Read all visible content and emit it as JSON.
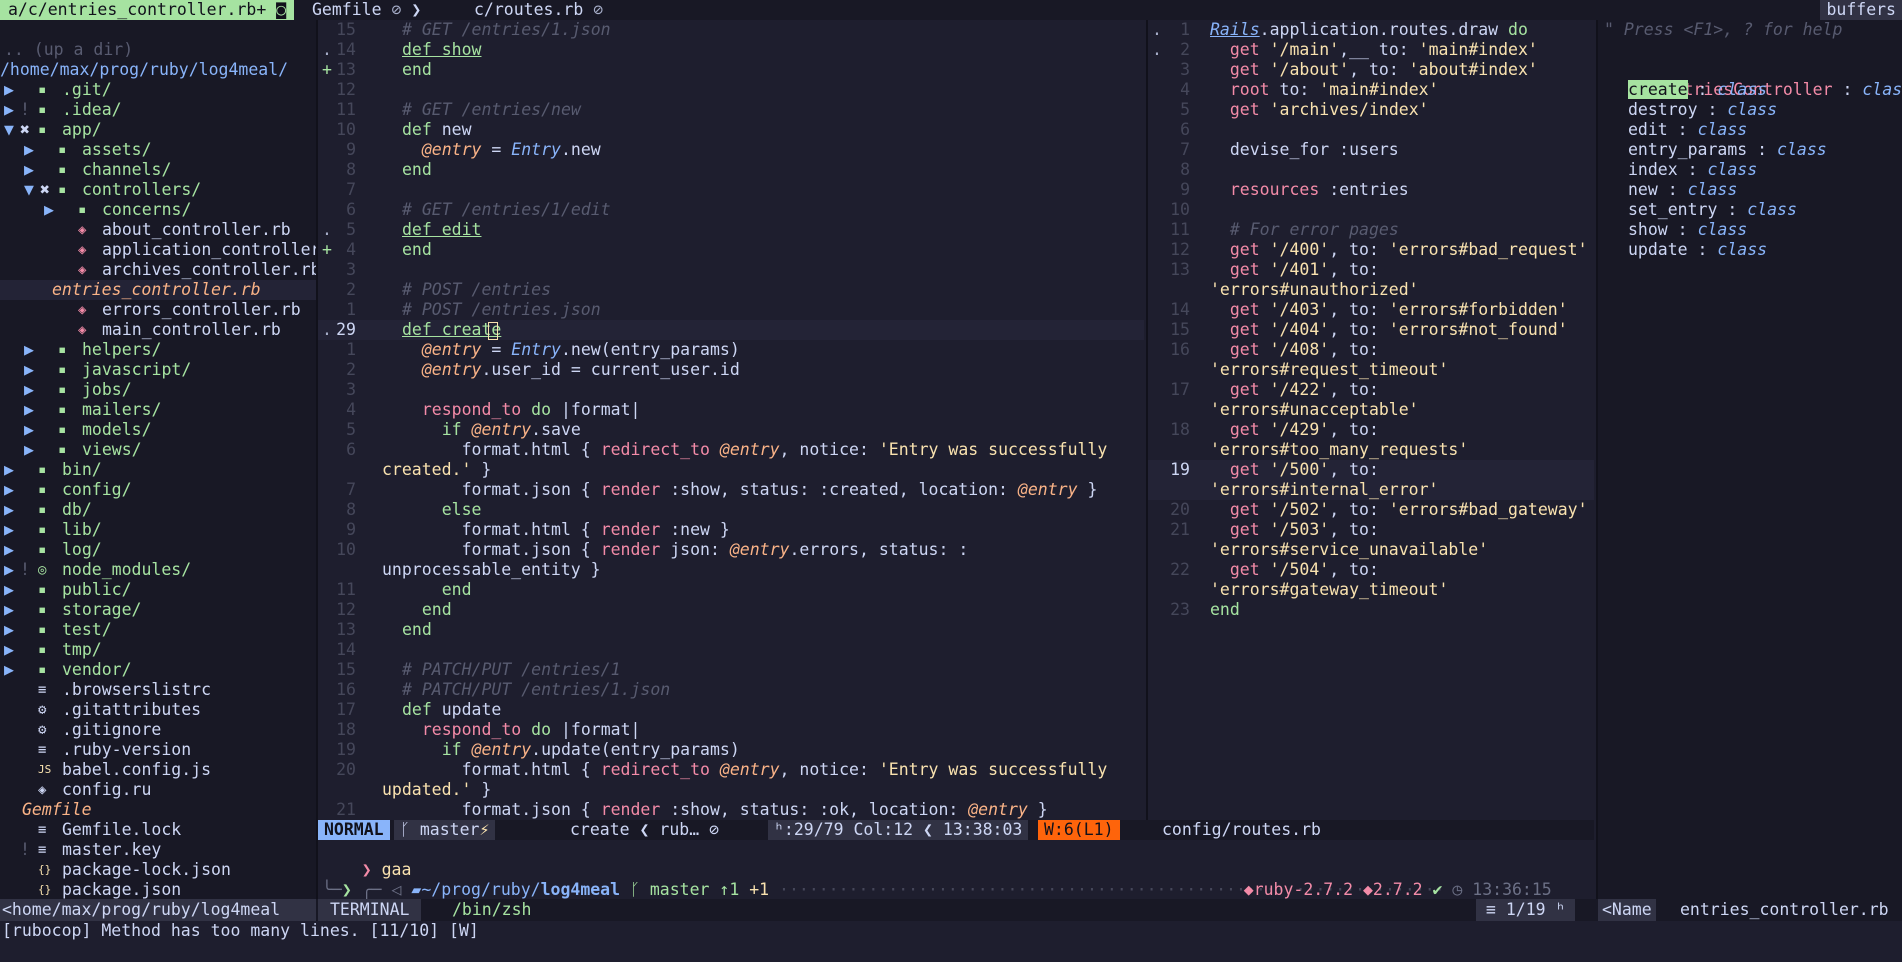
{
  "tabline": {
    "active_tab": "a/c/entries_controller.rb+",
    "tab2": "Gemfile",
    "tab3": "c/routes.rb",
    "buffers_label": "buffers"
  },
  "tree": {
    "up_dir": ".. (up a dir)",
    "root_path": "/home/max/prog/ruby/log4meal/",
    "items": [
      {
        "arrow": "▶",
        "mark": "",
        "icon": "▪",
        "label": ".git/",
        "type": "dir",
        "indent": 1
      },
      {
        "arrow": "▶",
        "mark": "!",
        "icon": "▪",
        "label": ".idea/",
        "type": "dir",
        "indent": 1
      },
      {
        "arrow": "▼",
        "mark": "✖",
        "icon": "▪",
        "label": "app/",
        "type": "dir",
        "indent": 1
      },
      {
        "arrow": "▶",
        "mark": "",
        "icon": "▪",
        "label": "assets/",
        "type": "dir",
        "indent": 3
      },
      {
        "arrow": "▶",
        "mark": "",
        "icon": "▪",
        "label": "channels/",
        "type": "dir",
        "indent": 3
      },
      {
        "arrow": "▼",
        "mark": "✖",
        "icon": "▪",
        "label": "controllers/",
        "type": "dir",
        "indent": 3
      },
      {
        "arrow": "▶",
        "mark": "",
        "icon": "▪",
        "label": "concerns/",
        "type": "dir",
        "indent": 5
      },
      {
        "arrow": "",
        "mark": "",
        "icon": "◈",
        "label": "about_controller.rb",
        "type": "ruby",
        "indent": 5
      },
      {
        "arrow": "",
        "mark": "",
        "icon": "◈",
        "label": "application_controller",
        "type": "ruby",
        "indent": 5
      },
      {
        "arrow": "",
        "mark": "",
        "icon": "◈",
        "label": "archives_controller.rb",
        "type": "ruby",
        "indent": 5
      },
      {
        "arrow": "",
        "mark": "",
        "icon": "",
        "label": "entries_controller.rb",
        "type": "active",
        "indent": 3
      },
      {
        "arrow": "",
        "mark": "",
        "icon": "◈",
        "label": "errors_controller.rb",
        "type": "ruby",
        "indent": 5
      },
      {
        "arrow": "",
        "mark": "",
        "icon": "◈",
        "label": "main_controller.rb",
        "type": "ruby",
        "indent": 5
      },
      {
        "arrow": "▶",
        "mark": "",
        "icon": "▪",
        "label": "helpers/",
        "type": "dir",
        "indent": 3
      },
      {
        "arrow": "▶",
        "mark": "",
        "icon": "▪",
        "label": "javascript/",
        "type": "dir",
        "indent": 3
      },
      {
        "arrow": "▶",
        "mark": "",
        "icon": "▪",
        "label": "jobs/",
        "type": "dir",
        "indent": 3
      },
      {
        "arrow": "▶",
        "mark": "",
        "icon": "▪",
        "label": "mailers/",
        "type": "dir",
        "indent": 3
      },
      {
        "arrow": "▶",
        "mark": "",
        "icon": "▪",
        "label": "models/",
        "type": "dir",
        "indent": 3
      },
      {
        "arrow": "▶",
        "mark": "",
        "icon": "▪",
        "label": "views/",
        "type": "dir",
        "indent": 3
      },
      {
        "arrow": "▶",
        "mark": "",
        "icon": "▪",
        "label": "bin/",
        "type": "dir",
        "indent": 1
      },
      {
        "arrow": "▶",
        "mark": "",
        "icon": "▪",
        "label": "config/",
        "type": "dir",
        "indent": 1
      },
      {
        "arrow": "▶",
        "mark": "",
        "icon": "▪",
        "label": "db/",
        "type": "dir",
        "indent": 1
      },
      {
        "arrow": "▶",
        "mark": "",
        "icon": "▪",
        "label": "lib/",
        "type": "dir",
        "indent": 1
      },
      {
        "arrow": "▶",
        "mark": "",
        "icon": "▪",
        "label": "log/",
        "type": "dir",
        "indent": 1
      },
      {
        "arrow": "▶",
        "mark": "!",
        "icon": "◎",
        "label": "node_modules/",
        "type": "dir",
        "indent": 1
      },
      {
        "arrow": "▶",
        "mark": "",
        "icon": "▪",
        "label": "public/",
        "type": "dir",
        "indent": 1
      },
      {
        "arrow": "▶",
        "mark": "",
        "icon": "▪",
        "label": "storage/",
        "type": "dir",
        "indent": 1
      },
      {
        "arrow": "▶",
        "mark": "",
        "icon": "▪",
        "label": "test/",
        "type": "dir",
        "indent": 1
      },
      {
        "arrow": "▶",
        "mark": "",
        "icon": "▪",
        "label": "tmp/",
        "type": "dir",
        "indent": 1
      },
      {
        "arrow": "▶",
        "mark": "",
        "icon": "▪",
        "label": "vendor/",
        "type": "dir",
        "indent": 1
      },
      {
        "arrow": "",
        "mark": "",
        "icon": "≡",
        "label": ".browserslistrc",
        "type": "file",
        "indent": 1
      },
      {
        "arrow": "",
        "mark": "",
        "icon": "⚙",
        "label": ".gitattributes",
        "type": "file",
        "indent": 1
      },
      {
        "arrow": "",
        "mark": "",
        "icon": "⚙",
        "label": ".gitignore",
        "type": "file",
        "indent": 1
      },
      {
        "arrow": "",
        "mark": "",
        "icon": "≡",
        "label": ".ruby-version",
        "type": "file",
        "indent": 1
      },
      {
        "arrow": "",
        "mark": "",
        "icon": "JS",
        "label": "babel.config.js",
        "type": "js",
        "indent": 1
      },
      {
        "arrow": "",
        "mark": "",
        "icon": "◈",
        "label": "config.ru",
        "type": "file",
        "indent": 1
      },
      {
        "arrow": "",
        "mark": "",
        "icon": "",
        "label": "Gemfile",
        "type": "gemfile",
        "indent": 0
      },
      {
        "arrow": "",
        "mark": "",
        "icon": "≡",
        "label": "Gemfile.lock",
        "type": "file",
        "indent": 1
      },
      {
        "arrow": "",
        "mark": "!",
        "icon": "≡",
        "label": "master.key",
        "type": "file",
        "indent": 1
      },
      {
        "arrow": "",
        "mark": "",
        "icon": "{}",
        "label": "package-lock.json",
        "type": "json",
        "indent": 1
      },
      {
        "arrow": "",
        "mark": "",
        "icon": "{}",
        "label": "package.json",
        "type": "json",
        "indent": 1
      }
    ]
  },
  "editor": {
    "lines": [
      {
        "n": "15",
        "sign": "",
        "html": "<span class='cm'># GET /entries/1.json</span>"
      },
      {
        "n": "14",
        "sign": ".",
        "html": "<span class='def'>def show</span>"
      },
      {
        "n": "13",
        "sign": "+",
        "html": "<span class='kw'>end</span>"
      },
      {
        "n": "12",
        "sign": "",
        "html": ""
      },
      {
        "n": "11",
        "sign": "",
        "html": "<span class='cm'># GET /entries/new</span>"
      },
      {
        "n": "10",
        "sign": "",
        "html": "<span class='kw'>def</span> new"
      },
      {
        "n": "9",
        "sign": "",
        "html": "  <span class='iv'>@entry</span> = <span class='cls'>Entry</span>.new"
      },
      {
        "n": "8",
        "sign": "",
        "html": "<span class='kw'>end</span>"
      },
      {
        "n": "7",
        "sign": "",
        "html": ""
      },
      {
        "n": "6",
        "sign": "",
        "html": "<span class='cm'># GET /entries/1/edit</span>"
      },
      {
        "n": "5",
        "sign": ".",
        "html": "<span class='def'>def edit</span>"
      },
      {
        "n": "4",
        "sign": "+",
        "html": "<span class='kw'>end</span>"
      },
      {
        "n": "3",
        "sign": "",
        "html": ""
      },
      {
        "n": "2",
        "sign": "",
        "html": "<span class='cm'># POST /entries</span>"
      },
      {
        "n": "1",
        "sign": "",
        "html": "<span class='cm'># POST /entries.json</span>"
      },
      {
        "n": "29",
        "sign": ".",
        "cur": true,
        "html": "<span class='def'>def create</span>"
      },
      {
        "n": "1",
        "sign": "",
        "html": "  <span class='iv'>@entry</span> = <span class='cls'>Entry</span>.new(entry_params)"
      },
      {
        "n": "2",
        "sign": "",
        "html": "  <span class='iv'>@entry</span>.user_id = current_user.id"
      },
      {
        "n": "3",
        "sign": "",
        "html": ""
      },
      {
        "n": "4",
        "sign": "",
        "html": "  <span class='meth'>respond_to</span> <span class='kw'>do</span> |format|"
      },
      {
        "n": "5",
        "sign": "",
        "html": "    <span class='kw'>if</span> <span class='iv'>@entry</span>.save"
      },
      {
        "n": "6",
        "sign": "",
        "html": "      format.html { <span class='meth'>redirect_to</span> <span class='iv'>@entry</span>, notice: <span class='str'>'Entry was successfully</span>"
      },
      {
        "n": "",
        "sign": "",
        "wrap": true,
        "html": "<span class='str'>created.'</span> }"
      },
      {
        "n": "7",
        "sign": "",
        "html": "      format.json { <span class='meth'>render</span> :show, status: :created, location: <span class='iv'>@entry</span> }"
      },
      {
        "n": "8",
        "sign": "",
        "html": "    <span class='kw'>else</span>"
      },
      {
        "n": "9",
        "sign": "",
        "html": "      format.html { <span class='meth'>render</span> :new }"
      },
      {
        "n": "10",
        "sign": "",
        "html": "      format.json { <span class='meth'>render</span> json: <span class='iv'>@entry</span>.errors, status: :"
      },
      {
        "n": "",
        "sign": "",
        "wrap": true,
        "html": "unprocessable_entity }"
      },
      {
        "n": "11",
        "sign": "",
        "html": "    <span class='kw'>end</span>"
      },
      {
        "n": "12",
        "sign": "",
        "html": "  <span class='kw'>end</span>"
      },
      {
        "n": "13",
        "sign": "",
        "html": "<span class='kw'>end</span>"
      },
      {
        "n": "14",
        "sign": "",
        "html": ""
      },
      {
        "n": "15",
        "sign": "",
        "html": "<span class='cm'># PATCH/PUT /entries/1</span>"
      },
      {
        "n": "16",
        "sign": "",
        "html": "<span class='cm'># PATCH/PUT /entries/1.json</span>"
      },
      {
        "n": "17",
        "sign": "",
        "html": "<span class='kw'>def</span> update"
      },
      {
        "n": "18",
        "sign": "",
        "html": "  <span class='meth'>respond_to</span> <span class='kw'>do</span> |format|"
      },
      {
        "n": "19",
        "sign": "",
        "html": "    <span class='kw'>if</span> <span class='iv'>@entry</span>.update(entry_params)"
      },
      {
        "n": "20",
        "sign": "",
        "html": "      format.html { <span class='meth'>redirect_to</span> <span class='iv'>@entry</span>, notice: <span class='str'>'Entry was successfully</span>"
      },
      {
        "n": "",
        "sign": "",
        "wrap": true,
        "html": "<span class='str'>updated.'</span> }"
      },
      {
        "n": "21",
        "sign": "",
        "html": "      format.json { <span class='meth'>render</span> :show, status: :ok, location: <span class='iv'>@entry</span> }"
      }
    ]
  },
  "routes": {
    "lines": [
      {
        "n": "1",
        "sign": ".",
        "html": "<span class='cls' style='text-decoration:underline'>Rails</span>.application.routes.draw <span class='kw'>do</span>"
      },
      {
        "n": "2",
        "sign": ".",
        "html": "  <span class='meth'>get</span> <span class='str'>'/main'</span>,__ to: <span class='str'>'main#index'</span>"
      },
      {
        "n": "3",
        "sign": "",
        "html": "  <span class='meth'>get</span> <span class='str'>'/about'</span>, to: <span class='str'>'about#index'</span>"
      },
      {
        "n": "4",
        "sign": "",
        "html": "  <span class='meth'>root</span> to: <span class='str'>'main#index'</span>"
      },
      {
        "n": "5",
        "sign": "",
        "html": "  <span class='meth'>get</span> <span class='str'>'archives/index'</span>"
      },
      {
        "n": "6",
        "sign": "",
        "html": ""
      },
      {
        "n": "7",
        "sign": "",
        "html": "  devise_for :users"
      },
      {
        "n": "8",
        "sign": "",
        "html": ""
      },
      {
        "n": "9",
        "sign": "",
        "html": "  <span class='meth'>resources</span> :entries"
      },
      {
        "n": "10",
        "sign": "",
        "html": ""
      },
      {
        "n": "11",
        "sign": "",
        "html": "  <span class='cm'># For error pages</span>"
      },
      {
        "n": "12",
        "sign": "",
        "html": "  <span class='meth'>get</span> <span class='str'>'/400'</span>, to: <span class='str'>'errors#bad_request'</span>"
      },
      {
        "n": "13",
        "sign": "",
        "html": "  <span class='meth'>get</span> <span class='str'>'/401'</span>, to:"
      },
      {
        "n": "",
        "sign": "",
        "html": "<span class='str'>'errors#unauthorized'</span>"
      },
      {
        "n": "14",
        "sign": "",
        "html": "  <span class='meth'>get</span> <span class='str'>'/403'</span>, to: <span class='str'>'errors#forbidden'</span>"
      },
      {
        "n": "15",
        "sign": "",
        "html": "  <span class='meth'>get</span> <span class='str'>'/404'</span>, to: <span class='str'>'errors#not_found'</span>"
      },
      {
        "n": "16",
        "sign": "",
        "html": "  <span class='meth'>get</span> <span class='str'>'/408'</span>, to:"
      },
      {
        "n": "",
        "sign": "",
        "html": "<span class='str'>'errors#request_timeout'</span>"
      },
      {
        "n": "17",
        "sign": "",
        "html": "  <span class='meth'>get</span> <span class='str'>'/422'</span>, to:"
      },
      {
        "n": "",
        "sign": "",
        "html": "<span class='str'>'errors#unacceptable'</span>"
      },
      {
        "n": "18",
        "sign": "",
        "html": "  <span class='meth'>get</span> <span class='str'>'/429'</span>, to:"
      },
      {
        "n": "",
        "sign": "",
        "html": "<span class='str'>'errors#too_many_requests'</span>"
      },
      {
        "n": "19",
        "sign": "",
        "cur": true,
        "html": "  <span class='meth'>get</span> <span class='str'>'/500'</span>, to:"
      },
      {
        "n": "",
        "sign": "",
        "cur": true,
        "html": "<span class='str'>'errors#internal_error'</span>"
      },
      {
        "n": "20",
        "sign": "",
        "html": "  <span class='meth'>get</span> <span class='str'>'/502'</span>, to: <span class='str'>'errors#bad_gateway'</span>"
      },
      {
        "n": "21",
        "sign": "",
        "html": "  <span class='meth'>get</span> <span class='str'>'/503'</span>, to:"
      },
      {
        "n": "",
        "sign": "",
        "html": "<span class='str'>'errors#service_unavailable'</span>"
      },
      {
        "n": "22",
        "sign": "",
        "html": "  <span class='meth'>get</span> <span class='str'>'/504'</span>, to:"
      },
      {
        "n": "",
        "sign": "",
        "html": "<span class='str'>'errors#gateway_timeout'</span>"
      },
      {
        "n": "23",
        "sign": "",
        "html": "<span class='kw'>end</span>"
      }
    ]
  },
  "outline": {
    "help_hint": "\" Press <F1>, ? for help",
    "root_name": "EntriesController",
    "root_kind": "class",
    "items": [
      {
        "name": "create",
        "kind": "class",
        "selected": true
      },
      {
        "name": "destroy",
        "kind": "class"
      },
      {
        "name": "edit",
        "kind": "class"
      },
      {
        "name": "entry_params",
        "kind": "class"
      },
      {
        "name": "index",
        "kind": "class"
      },
      {
        "name": "new",
        "kind": "class"
      },
      {
        "name": "set_entry",
        "kind": "class"
      },
      {
        "name": "show",
        "kind": "class"
      },
      {
        "name": "update",
        "kind": "class"
      }
    ]
  },
  "statusline": {
    "mode": "NORMAL",
    "branch": "master",
    "branch_glyph": "⚡",
    "func": "create",
    "filetype": "rub…",
    "position": "ʰ:29/79 Col:12",
    "time": "13:38:03",
    "warnings": "W:6(L1)",
    "routes_file": "config/routes.rb"
  },
  "terminal": {
    "command": "gaa",
    "path_prefix": "~/prog/ruby/",
    "path_dir": "log4meal",
    "branch": "master",
    "ahead": "↑1",
    "changes": "+1",
    "ruby_env": "ruby-2.7.2",
    "ruby_ver": "2.7.2",
    "clock": "13:36:15"
  },
  "bottombar": {
    "tree_path": "<home/max/prog/ruby/log4meal",
    "term_label": "TERMINAL",
    "shell": "/bin/zsh",
    "term_pos": "≡ 1/19 ʰ",
    "outline_label": "<Name",
    "outline_file": "entries_controller.rb"
  },
  "message": "[rubocop] Method has too many lines. [11/10] [W]"
}
